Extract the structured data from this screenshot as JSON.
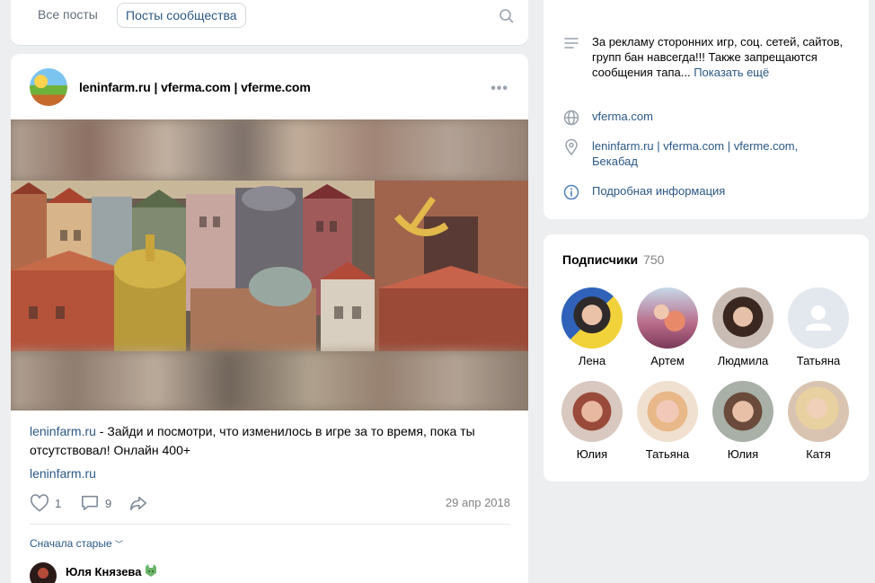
{
  "tabs": {
    "all_posts": "Все посты",
    "community_posts": "Посты сообщества"
  },
  "post": {
    "author": "leninfarm.ru | vferma.com | vferme.com",
    "text_link": "leninfarm.ru",
    "text_body": " - Зайди и посмотри, что изменилось в игре за то время, пока ты отсутствовал! Онлайн 400+",
    "link": "leninfarm.ru",
    "likes": "1",
    "comments": "9",
    "date": "29 апр 2018"
  },
  "comments": {
    "sort_label": "Сначала старые",
    "first_author": "Юля Князева"
  },
  "info": {
    "description": "За рекламу сторонних игр, соц. сетей, сайтов, групп бан навсегда!!! Также запрещаются сообщения тапа...",
    "show_more": "Показать ещё",
    "website": "vferma.com",
    "address": "leninfarm.ru | vferma.com | vferme.com, Бекабад",
    "details": "Подробная информация"
  },
  "subscribers": {
    "title": "Подписчики",
    "count": "750",
    "people": [
      {
        "name": "Лена"
      },
      {
        "name": "Артем"
      },
      {
        "name": "Людмила"
      },
      {
        "name": "Татьяна"
      },
      {
        "name": "Юлия"
      },
      {
        "name": "Татьяна"
      },
      {
        "name": "Юлия"
      },
      {
        "name": "Катя"
      }
    ]
  },
  "colors": {
    "link": "#2a5885",
    "muted": "#626d7a",
    "background": "#edeef0"
  },
  "icons": [
    "search-icon",
    "more-icon",
    "like-icon",
    "comment-icon",
    "share-icon",
    "description-icon",
    "globe-icon",
    "location-icon",
    "info-icon",
    "chevron-down-icon",
    "default-avatar-icon"
  ]
}
